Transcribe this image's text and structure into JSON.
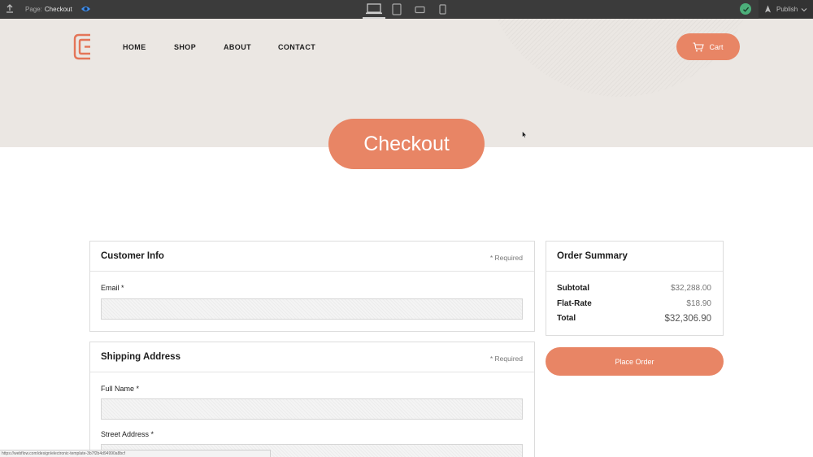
{
  "designer": {
    "page_prefix": "Page:",
    "page_name": "Checkout",
    "publish_label": "Publish",
    "devices": [
      "desktop",
      "tablet",
      "mobile-landscape",
      "mobile-portrait"
    ],
    "active_device": "desktop"
  },
  "site": {
    "nav": [
      {
        "label": "HOME"
      },
      {
        "label": "SHOP"
      },
      {
        "label": "ABOUT"
      },
      {
        "label": "CONTACT"
      }
    ],
    "cart_label": "Cart",
    "page_title": "Checkout"
  },
  "customer_info": {
    "title": "Customer Info",
    "required_note": "* Required",
    "email_label": "Email *",
    "email_value": ""
  },
  "shipping": {
    "title": "Shipping Address",
    "required_note": "* Required",
    "full_name_label": "Full Name *",
    "full_name_value": "",
    "street_label": "Street Address *",
    "street_value": ""
  },
  "order_summary": {
    "title": "Order Summary",
    "rows": [
      {
        "label": "Subtotal",
        "value": "$32,288.00"
      },
      {
        "label": "Flat-Rate",
        "value": "$18.90"
      },
      {
        "label": "Total",
        "value": "$32,306.90"
      }
    ]
  },
  "place_order_label": "Place Order",
  "status_url": "https://webflow.com/design/electronic-template-3b7f2b4d94990a8bcf",
  "colors": {
    "accent": "#e88565",
    "hero_bg": "#ebe7e3",
    "topbar_bg": "#3b3b3b",
    "status_ok": "#4caf7a"
  }
}
